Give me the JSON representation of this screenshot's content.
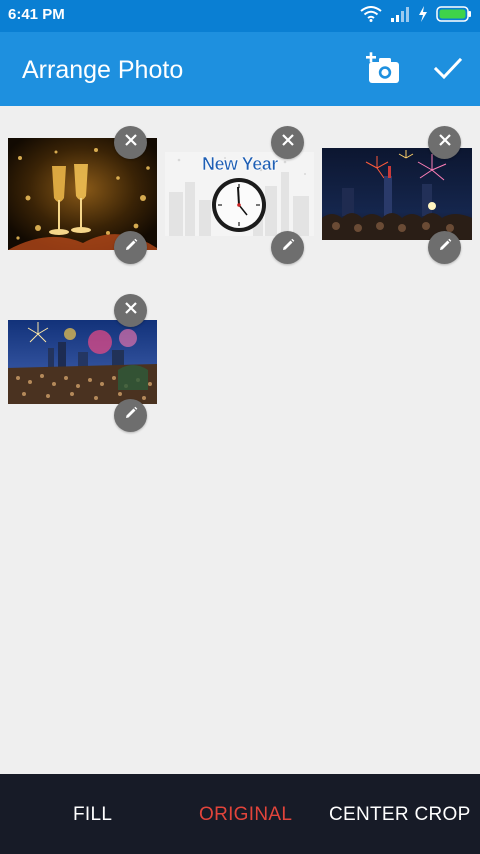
{
  "status": {
    "time": "6:41 PM"
  },
  "app_bar": {
    "title": "Arrange Photo",
    "icons": [
      "add-photo-icon",
      "check-icon"
    ]
  },
  "photos": [
    {
      "name": "champagne-glasses",
      "remove_icon": "close-icon",
      "edit_icon": "pencil-icon"
    },
    {
      "name": "new-year-clock",
      "caption": "New Year",
      "remove_icon": "close-icon",
      "edit_icon": "pencil-icon"
    },
    {
      "name": "city-fireworks-night",
      "remove_icon": "close-icon",
      "edit_icon": "pencil-icon"
    },
    {
      "name": "crowd-fireworks",
      "remove_icon": "close-icon",
      "edit_icon": "pencil-icon"
    }
  ],
  "bottom_bar": {
    "modes": [
      "FILL",
      "ORIGINAL",
      "CENTER CROP"
    ],
    "active_mode": "ORIGINAL"
  },
  "colors": {
    "status_bar": "#0a7fd3",
    "app_bar": "#1e90df",
    "background": "#efefef",
    "bottom_bar": "#171b27",
    "active_mode": "#e2443b"
  }
}
